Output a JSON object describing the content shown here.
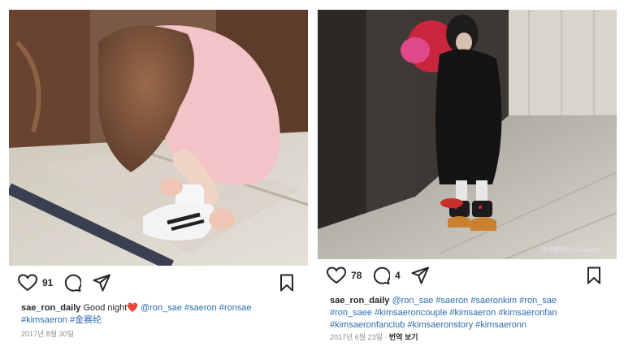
{
  "left_post": {
    "likes": "91",
    "username": "sae_ron_daily",
    "caption_text": "Good night",
    "caption_emoji": "❤️",
    "tags_line1": [
      "@ron_sae",
      "#saeron",
      "#ronsae"
    ],
    "tags_line2": [
      "#kimsaeron",
      "#金赛纶"
    ],
    "date": "2017년 8월 30일"
  },
  "right_post": {
    "likes": "78",
    "comments": "4",
    "username": "sae_ron_daily",
    "tags_line1": [
      "@ron_sae",
      "#saeron",
      "#saeronkim",
      "#ron_sae"
    ],
    "tags_line2": [
      "#ron_saee",
      "#kimsaeroncouple",
      "#kimsaeron",
      "#kimsaeronfan"
    ],
    "tags_line3": [
      "#kimsaeronfanclub",
      "#kimsaeronstory",
      "#kimsaeronn"
    ],
    "date": "2017년 6월 23일",
    "translate_label": "번역 보기",
    "watermark": "@金赛纶KimSaeron"
  },
  "icons": {
    "like": "heart-outline-icon",
    "comment": "comment-bubble-icon",
    "share": "paper-plane-icon",
    "save": "bookmark-icon"
  }
}
